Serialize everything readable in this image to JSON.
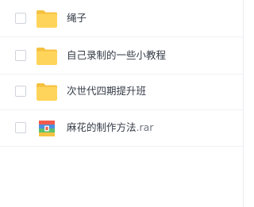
{
  "files": [
    {
      "name": "绳子",
      "ext": "",
      "type": "folder",
      "icon": "folder-icon"
    },
    {
      "name": "自己录制的一些小教程",
      "ext": "",
      "type": "folder",
      "icon": "folder-icon"
    },
    {
      "name": "次世代四期提升班",
      "ext": "",
      "type": "folder",
      "icon": "folder-icon"
    },
    {
      "name": "麻花的制作方法",
      "ext": ".rar",
      "type": "archive",
      "icon": "rar-archive-icon"
    }
  ],
  "colors": {
    "folder": "#ffd45a",
    "folder_tab": "#f5c140",
    "archive_red": "#f15b4c",
    "archive_blue": "#4a90e2",
    "archive_green": "#5cc16c",
    "archive_yellow": "#f6c343"
  }
}
